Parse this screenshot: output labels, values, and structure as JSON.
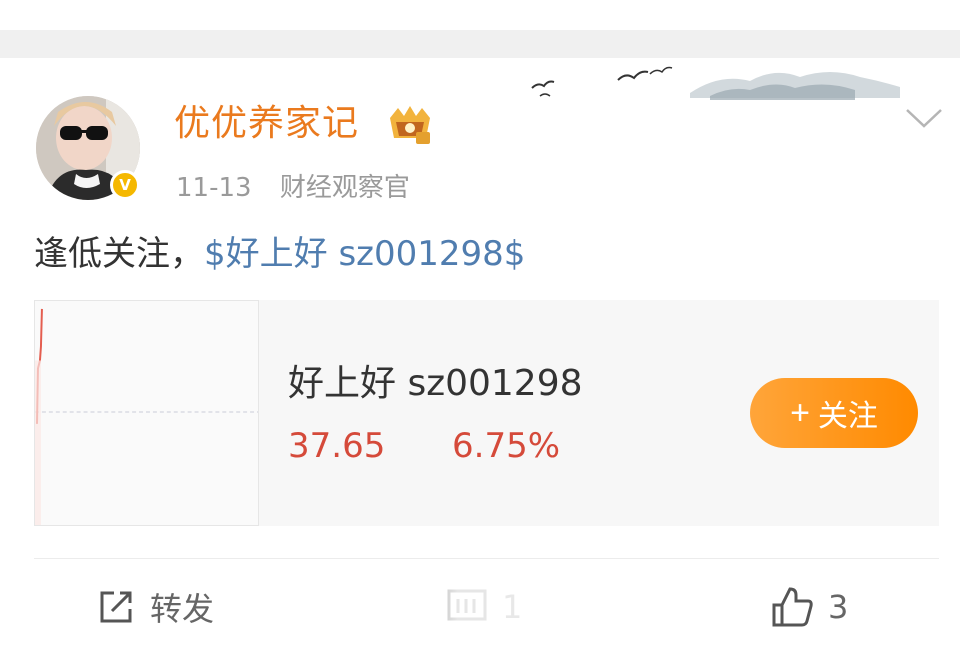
{
  "post": {
    "username": "优优养家记",
    "date": "11-13",
    "source": "财经观察官",
    "text_prefix": "逢低关注，",
    "stock_link": "$好上好 sz001298$"
  },
  "stock_card": {
    "name": "好上好 sz001298",
    "price": "37.65",
    "change": "6.75%",
    "follow_label": "关注",
    "follow_plus": "+"
  },
  "actions": {
    "repost_label": "转发",
    "comment_count": "1",
    "like_count": "3"
  },
  "colors": {
    "username": "#ea7a1e",
    "link": "#507daf",
    "price_up": "#d54a3a",
    "follow_button": "#ff8a00",
    "verify_badge": "#f5b800"
  }
}
